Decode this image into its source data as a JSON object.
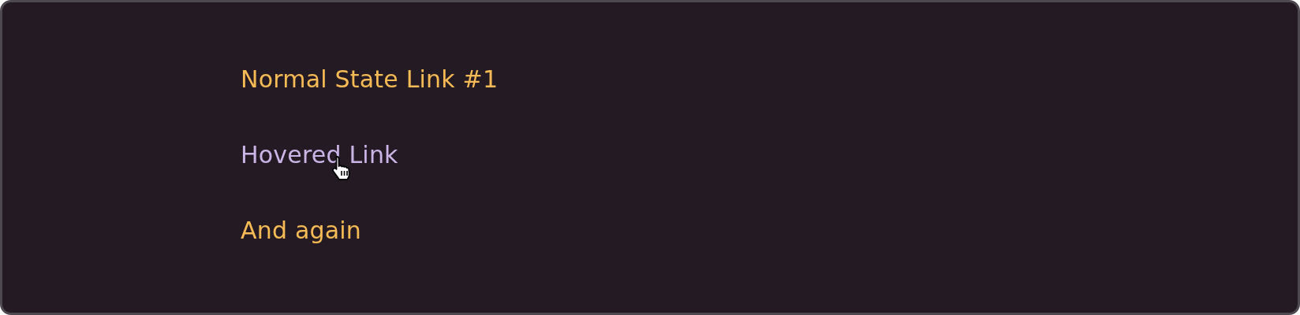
{
  "links": [
    {
      "label": "Normal State Link #1",
      "hovered": false
    },
    {
      "label": "Hovered Link",
      "hovered": true
    },
    {
      "label": "And again",
      "hovered": false
    }
  ]
}
